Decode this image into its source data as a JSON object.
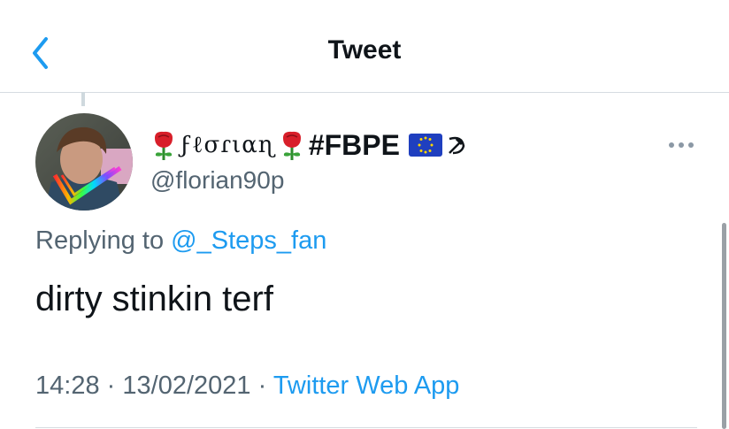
{
  "header": {
    "title": "Tweet",
    "back_icon": "chevron-left-icon",
    "accent_color": "#1d9bf0"
  },
  "tweet": {
    "display_name": {
      "script_name": "ϝℓσɾιαɳ",
      "hashtag": "#FBPE",
      "icons": [
        "rose-emoji",
        "rose-emoji",
        "eu-flag-emoji",
        "hammer-sickle-emoji"
      ]
    },
    "handle": "@florian90p",
    "replying_prefix": "Replying to",
    "replying_to": "@_Steps_fan",
    "text": "dirty stinkin terf",
    "time": "14:28",
    "date": "13/02/2021",
    "separator": "·",
    "source": "Twitter Web App"
  },
  "colors": {
    "link": "#1d9bf0",
    "secondary_text": "#536471",
    "primary_text": "#0f1419",
    "divider": "#d6dce1"
  }
}
